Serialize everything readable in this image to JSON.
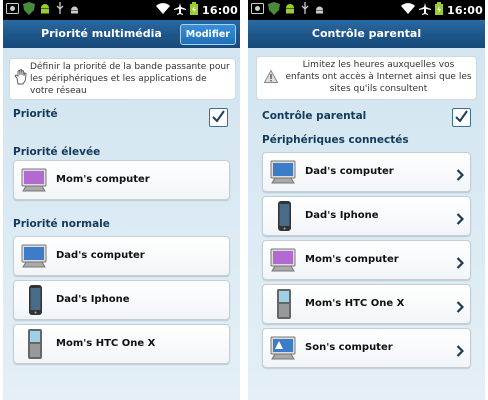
{
  "status": {
    "time": "16:00"
  },
  "left": {
    "title": "Priorité multimédia",
    "modify_button": "Modifier",
    "info": "Définir la priorité de la bande passante pour les périphériques et les applications de votre réseau",
    "priority_label": "Priorité",
    "priority_checked": true,
    "high_label": "Priorité élevée",
    "high_devices": [
      {
        "name": "Mom's computer",
        "icon": "desktop-computer-purple-icon"
      }
    ],
    "normal_label": "Priorité normale",
    "normal_devices": [
      {
        "name": "Dad's computer",
        "icon": "desktop-computer-icon"
      },
      {
        "name": "Dad's Iphone",
        "icon": "smartphone-icon"
      },
      {
        "name": "Mom's HTC One X",
        "icon": "handheld-phone-icon"
      }
    ]
  },
  "right": {
    "title": "Contrôle parental",
    "info": "Limitez les heures auxquelles vos enfants ont accès à Internet ainsi que les sites qu'ils consultent",
    "control_label": "Contrôle parental",
    "control_checked": true,
    "devices_label": "Périphériques connectés",
    "devices": [
      {
        "name": "Dad's computer",
        "icon": "desktop-computer-icon"
      },
      {
        "name": "Dad's Iphone",
        "icon": "smartphone-icon"
      },
      {
        "name": "Mom's computer",
        "icon": "desktop-computer-purple-icon"
      },
      {
        "name": "Mom's HTC One X",
        "icon": "handheld-phone-icon"
      },
      {
        "name": "Son's computer",
        "icon": "desktop-computer-icon"
      }
    ]
  },
  "colors": {
    "titlebar": "#1e5589",
    "accent_button": "#1f6fb8",
    "section_label": "#123a5c",
    "background": "#d6e7f1"
  }
}
